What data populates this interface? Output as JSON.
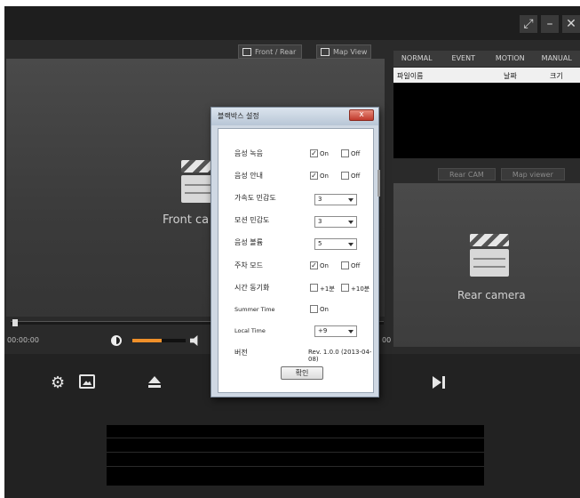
{
  "window": {
    "controls": [
      "⤢",
      "–",
      "✕"
    ]
  },
  "view_buttons": {
    "front_rear": "Front / Rear",
    "map_view": "Map View"
  },
  "front_panel": {
    "label": "Front ca"
  },
  "player": {
    "time": "00:00:00",
    "volume_level": 0.55,
    "time_right": "00"
  },
  "right_tabs": [
    "NORMAL",
    "EVENT",
    "MOTION",
    "MANUAL"
  ],
  "file_list": {
    "col_filename": "파일이름",
    "col_date": "날짜",
    "col_size": "크기"
  },
  "rear_buttons": {
    "rear_cam": "Rear CAM",
    "map_viewer": "Map viewer"
  },
  "rear_panel": {
    "label": "Rear camera"
  },
  "dialog": {
    "title": "블랙박스 설정",
    "close": "x",
    "rows": {
      "audio_record": {
        "label": "음성 녹음",
        "on": "On",
        "off": "Off",
        "on_checked": true,
        "off_checked": false
      },
      "voice_guide": {
        "label": "음성 안내",
        "on": "On",
        "off": "Off",
        "on_checked": true,
        "off_checked": false
      },
      "accel_sensitivity": {
        "label": "가속도 민감도",
        "value": "3"
      },
      "motion_sensitivity": {
        "label": "모션 민감도",
        "value": "3"
      },
      "volume": {
        "label": "음성 볼륨",
        "value": "5"
      },
      "parking_mode": {
        "label": "주차 모드",
        "on": "On",
        "off": "Off",
        "on_checked": true,
        "off_checked": false
      },
      "time_sync": {
        "label": "시간 동기화",
        "opt1": "+1분",
        "opt2": "+10분"
      },
      "summer_time": {
        "label": "Summer Time",
        "on": "On"
      },
      "local_time": {
        "label": "Local Time",
        "value": "+9"
      },
      "version": {
        "label": "버전",
        "value": "Rev. 1.0.0 (2013-04-08)"
      }
    },
    "ok_button": "확인"
  }
}
